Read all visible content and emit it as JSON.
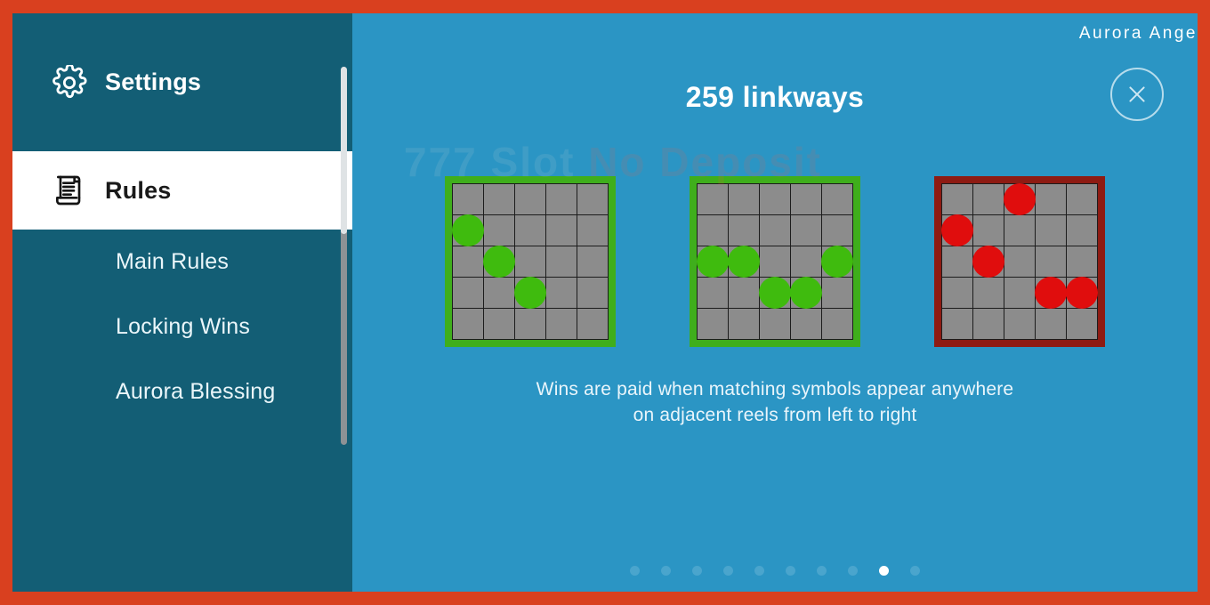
{
  "window": {
    "border_color": "#d9401f",
    "sidebar_color": "#135e75",
    "panel_color": "#2b95c4"
  },
  "game": {
    "title": "Aurora Ange"
  },
  "sidebar": {
    "header": {
      "label": "Settings",
      "icon": "gear-icon"
    },
    "active_section": {
      "label": "Rules",
      "icon": "scroll-document-icon"
    },
    "items": [
      {
        "label": "Main Rules"
      },
      {
        "label": "Locking Wins"
      },
      {
        "label": "Aurora Blessing"
      }
    ],
    "scrollbar": {
      "visible": true
    }
  },
  "main": {
    "close_label": "×",
    "panel_title": "259 linkways",
    "description_line1": "Wins are paid when matching symbols appear anywhere",
    "description_line2": "on adjacent reels from left to right",
    "watermark": {
      "prefix": "777",
      "middle": "Slot",
      "suffix": "No Deposit"
    }
  },
  "grids": {
    "columns": 5,
    "rows": 5,
    "items": [
      {
        "name": "winning-pattern-diagonal",
        "frame_color": "#3fae1c",
        "symbol_color": "#3fbb0e",
        "valid": true,
        "positions": [
          {
            "col": 0,
            "row": 1
          },
          {
            "col": 1,
            "row": 2
          },
          {
            "col": 2,
            "row": 3
          }
        ]
      },
      {
        "name": "winning-pattern-wave",
        "frame_color": "#3fae1c",
        "symbol_color": "#3fbb0e",
        "valid": true,
        "positions": [
          {
            "col": 0,
            "row": 2
          },
          {
            "col": 1,
            "row": 2
          },
          {
            "col": 2,
            "row": 3
          },
          {
            "col": 3,
            "row": 3
          },
          {
            "col": 4,
            "row": 2
          }
        ]
      },
      {
        "name": "losing-pattern-nonadjacent",
        "frame_color": "#8e1b13",
        "symbol_color": "#e00d0d",
        "valid": false,
        "positions": [
          {
            "col": 2,
            "row": 0
          },
          {
            "col": 0,
            "row": 1
          },
          {
            "col": 1,
            "row": 2
          },
          {
            "col": 3,
            "row": 3
          },
          {
            "col": 4,
            "row": 3
          }
        ]
      }
    ]
  },
  "pagination": {
    "total": 10,
    "active_index": 8
  }
}
